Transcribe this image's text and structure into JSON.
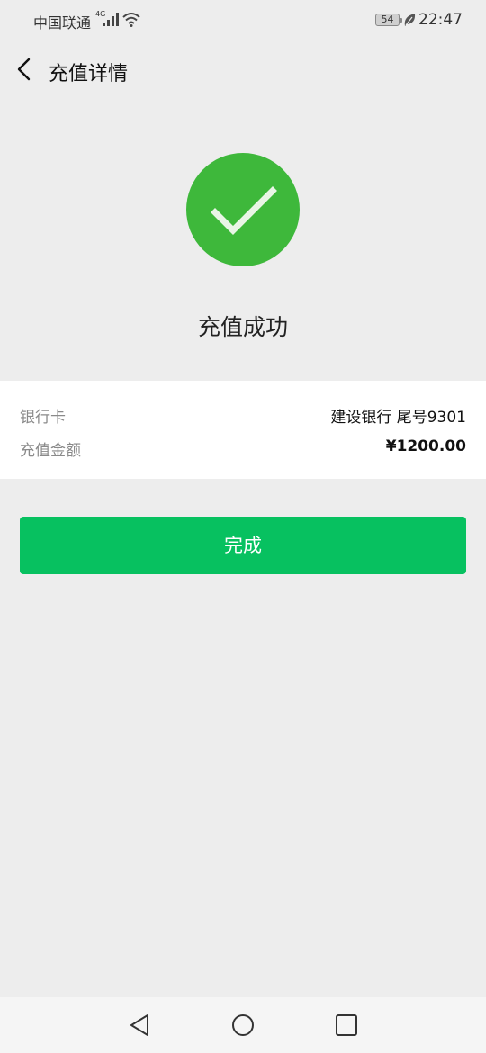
{
  "status_bar": {
    "carrier": "中国联通",
    "network": "4G",
    "battery": "54",
    "time": "22:47"
  },
  "nav": {
    "title": "充值详情",
    "back_icon": "chevron-left-icon"
  },
  "result": {
    "icon": "checkmark-circle-icon",
    "title": "充值成功",
    "color": "#3eb83b"
  },
  "details": {
    "rows": [
      {
        "label": "银行卡",
        "value": "建设银行 尾号9301"
      },
      {
        "label": "充值金额",
        "value": "¥1200.00"
      }
    ]
  },
  "actions": {
    "done_label": "完成",
    "accent": "#07c160"
  },
  "system_nav": {
    "icons": [
      "back-triangle-icon",
      "home-circle-icon",
      "recents-square-icon"
    ]
  }
}
